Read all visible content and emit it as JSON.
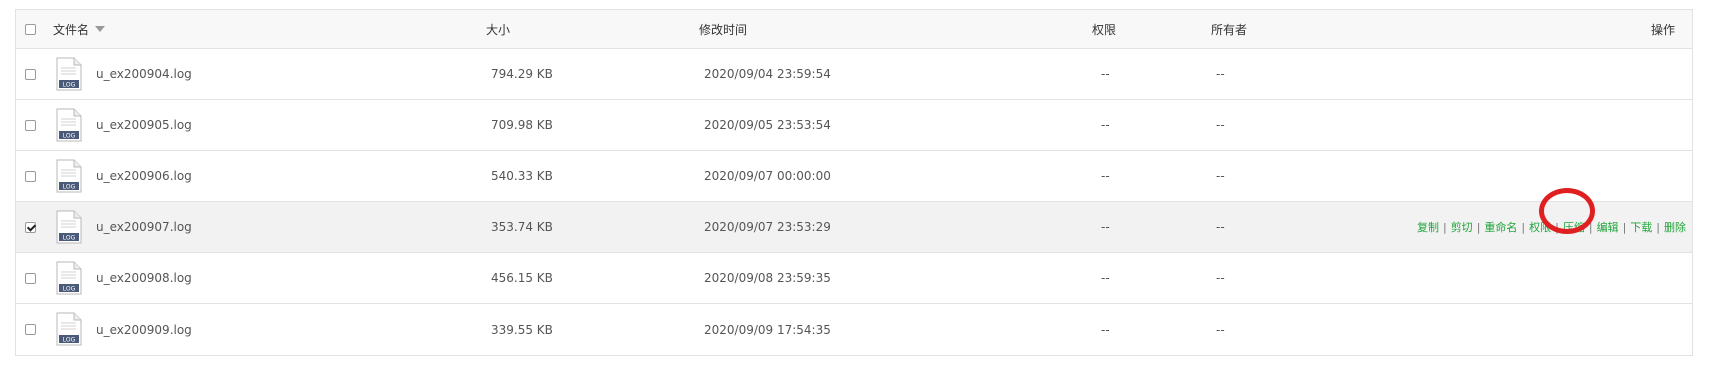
{
  "header": {
    "name": "文件名",
    "size": "大小",
    "mtime": "修改时间",
    "perm": "权限",
    "owner": "所有者",
    "ops": "操作"
  },
  "file_icon_label": "LOG",
  "files": [
    {
      "name": "u_ex200904.log",
      "size": "794.29 KB",
      "mtime": "2020/09/04 23:59:54",
      "perm": "--",
      "owner": "--",
      "checked": false
    },
    {
      "name": "u_ex200905.log",
      "size": "709.98 KB",
      "mtime": "2020/09/05 23:53:54",
      "perm": "--",
      "owner": "--",
      "checked": false
    },
    {
      "name": "u_ex200906.log",
      "size": "540.33 KB",
      "mtime": "2020/09/07 00:00:00",
      "perm": "--",
      "owner": "--",
      "checked": false
    },
    {
      "name": "u_ex200907.log",
      "size": "353.74 KB",
      "mtime": "2020/09/07 23:53:29",
      "perm": "--",
      "owner": "--",
      "checked": true
    },
    {
      "name": "u_ex200908.log",
      "size": "456.15 KB",
      "mtime": "2020/09/08 23:59:35",
      "perm": "--",
      "owner": "--",
      "checked": false
    },
    {
      "name": "u_ex200909.log",
      "size": "339.55 KB",
      "mtime": "2020/09/09 17:54:35",
      "perm": "--",
      "owner": "--",
      "checked": false
    }
  ],
  "row_actions": {
    "copy": "复制",
    "cut": "剪切",
    "rename": "重命名",
    "permission": "权限",
    "compress": "压缩",
    "edit": "编辑",
    "download": "下载",
    "delete": "删除",
    "separator": "|"
  },
  "colors": {
    "action": "#20a53a",
    "highlight_circle": "#e02020"
  }
}
